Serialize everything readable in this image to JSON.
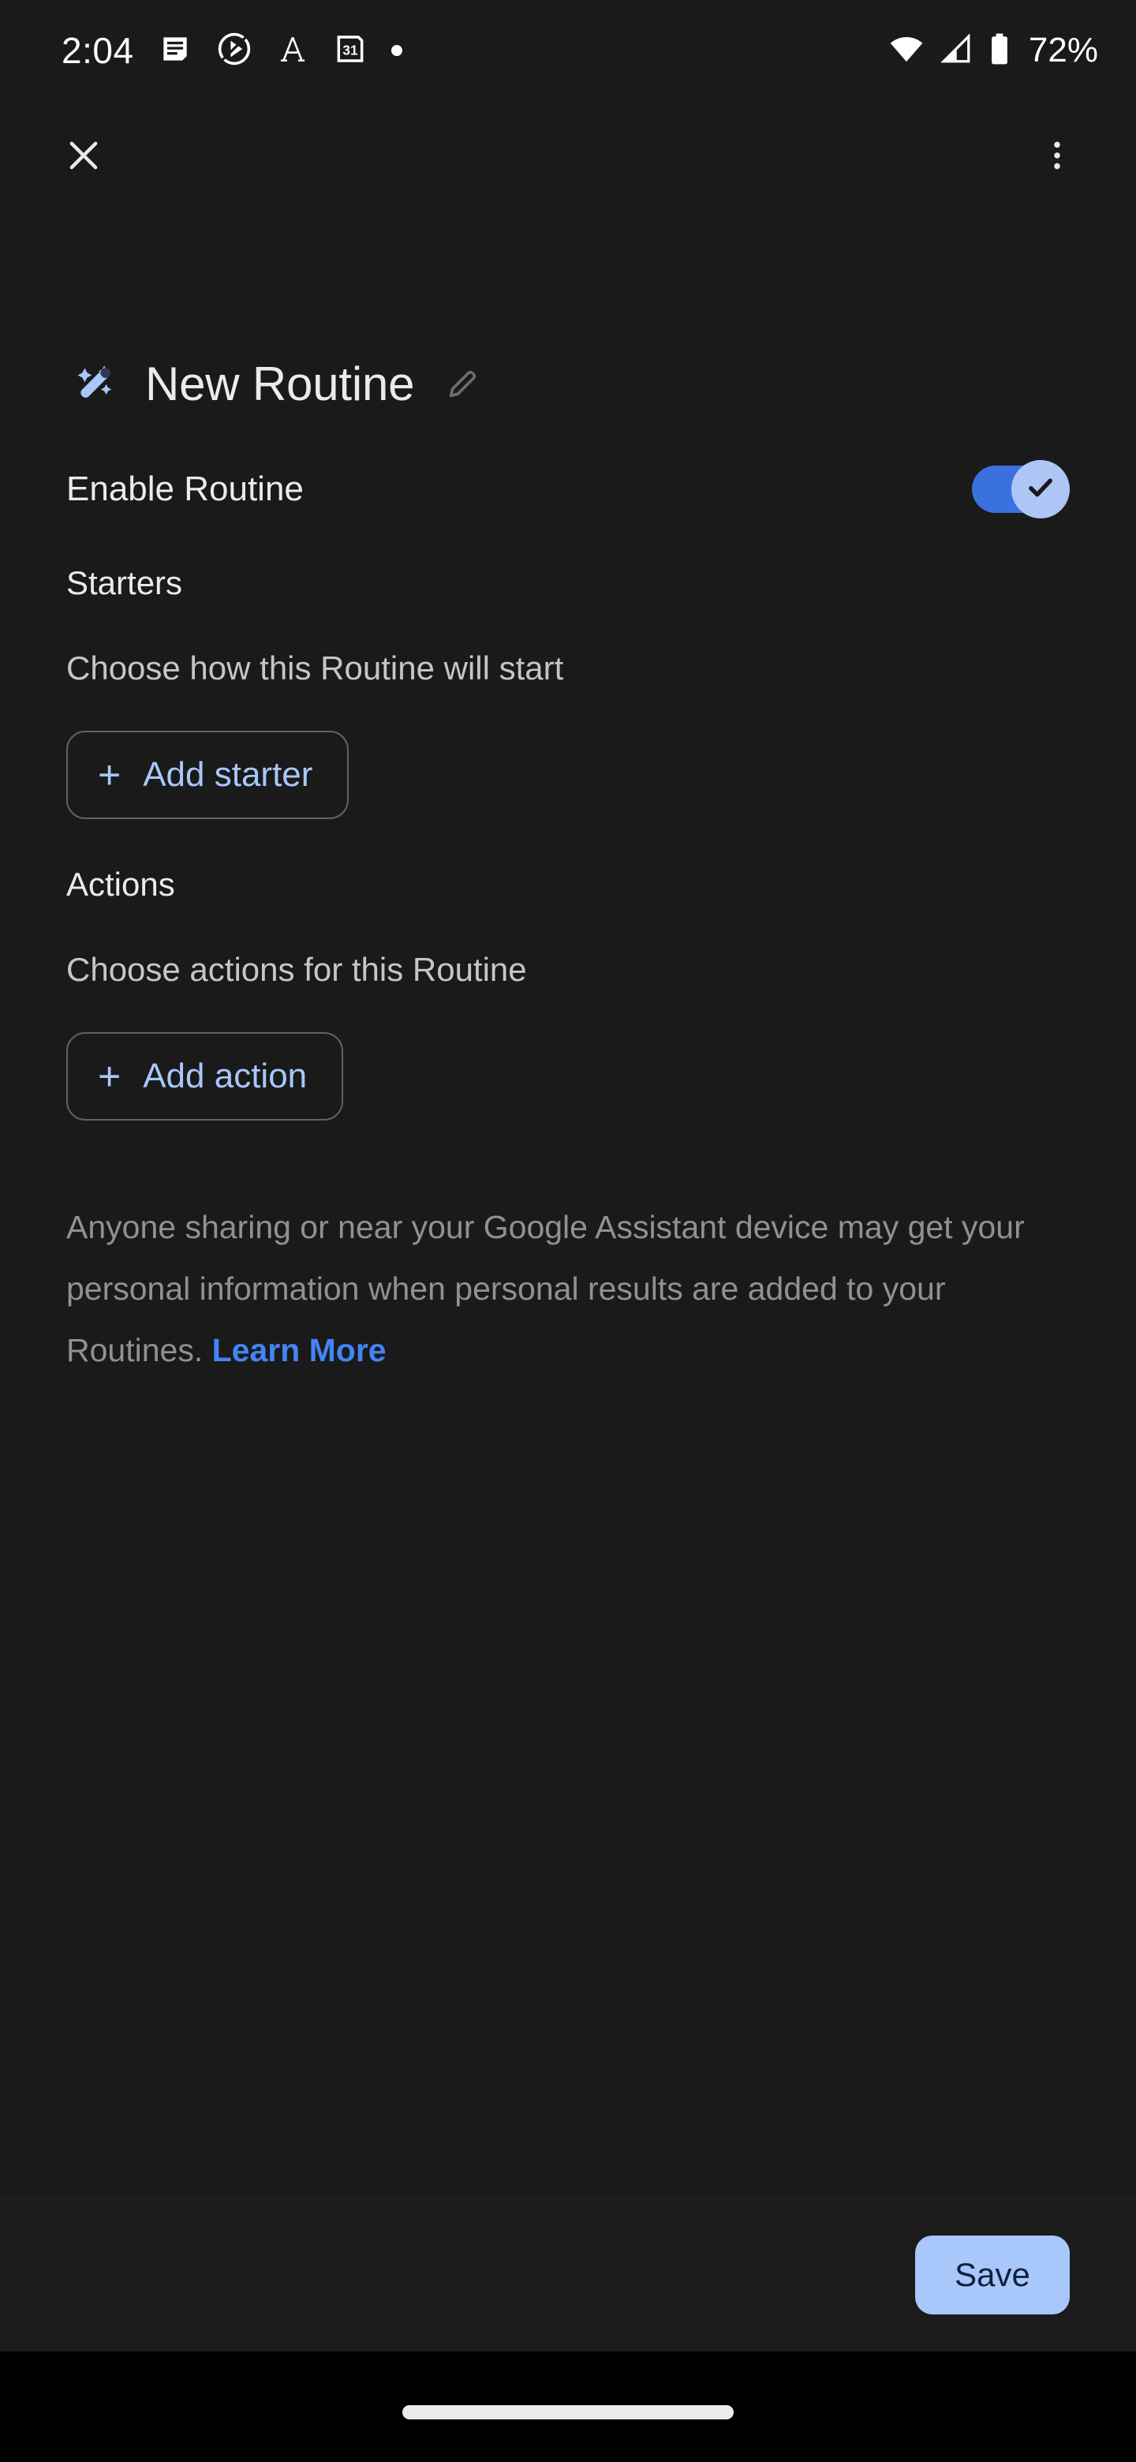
{
  "status_bar": {
    "time": "2:04",
    "battery_percent": "72%",
    "left_icons": [
      "notes-icon",
      "drive-play-icon",
      "font-a-icon",
      "calendar-31-icon",
      "more-notifications-dot-icon"
    ],
    "right_icons": [
      "wifi-icon",
      "cellular-signal-icon",
      "battery-icon"
    ],
    "calendar_day": "31"
  },
  "app_bar": {
    "close_label": "Close",
    "overflow_label": "More options"
  },
  "header": {
    "icon": "magic-wand-icon",
    "title": "New Routine",
    "edit_icon": "pencil-edit-icon"
  },
  "enable": {
    "label": "Enable Routine",
    "state": "on"
  },
  "starters": {
    "heading": "Starters",
    "description": "Choose how this Routine will start",
    "add_button": "Add starter",
    "plus": "+"
  },
  "actions": {
    "heading": "Actions",
    "description": "Choose actions for this Routine",
    "add_button": "Add action",
    "plus": "+"
  },
  "disclaimer": {
    "text": "Anyone sharing or near your Google Assistant device may get your personal information when personal results are added to your Routines. ",
    "link_label": "Learn More"
  },
  "bottom_bar": {
    "save_label": "Save"
  },
  "colors": {
    "background": "#1a1a1a",
    "accent_blue": "#a8c7fa",
    "toggle_track": "#3b71de",
    "link_blue": "#4285f4",
    "primary_text": "#ebebeb",
    "secondary_text": "#c4c7c5",
    "disclaimer_text": "#8f9194"
  }
}
